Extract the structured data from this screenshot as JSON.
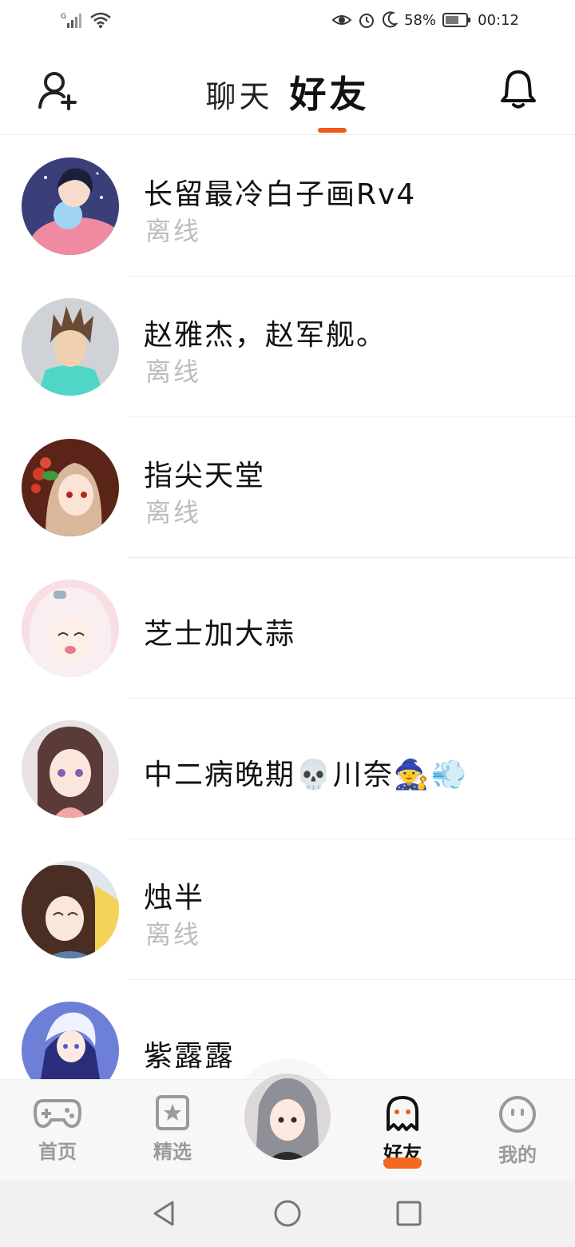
{
  "status_bar": {
    "network": "G",
    "network_sub": "4G",
    "battery_percent": "58%",
    "time": "00:12"
  },
  "header": {
    "tab_chat": "聊天",
    "tab_friends": "好友",
    "active_tab": "好友"
  },
  "friends": [
    {
      "name": "长留最冷白子画Rv4",
      "status": "离线",
      "avatar": "avatar-boy-pink-hoodie"
    },
    {
      "name": "赵雅杰，赵军舰。",
      "status": "离线",
      "avatar": "avatar-spiky-hair-boy"
    },
    {
      "name": "指尖天堂",
      "status": "离线",
      "avatar": "avatar-girl-strawberries"
    },
    {
      "name": "芝士加大蒜",
      "status": "",
      "avatar": "avatar-pink-hair-girl"
    },
    {
      "name": "中二病晚期💀川奈🧙💨",
      "status": "",
      "avatar": "avatar-purple-hair-girl"
    },
    {
      "name": "烛半",
      "status": "离线",
      "avatar": "avatar-brown-hair-girl"
    },
    {
      "name": "紫露露",
      "status": "",
      "avatar": "avatar-white-hair-girl"
    }
  ],
  "bottom_nav": {
    "home": "首页",
    "picks": "精选",
    "friends": "好友",
    "me": "我的",
    "active": "好友"
  },
  "colors": {
    "accent": "#f05a1a",
    "offline_text": "#bdbdbd",
    "divider": "#ececec"
  }
}
